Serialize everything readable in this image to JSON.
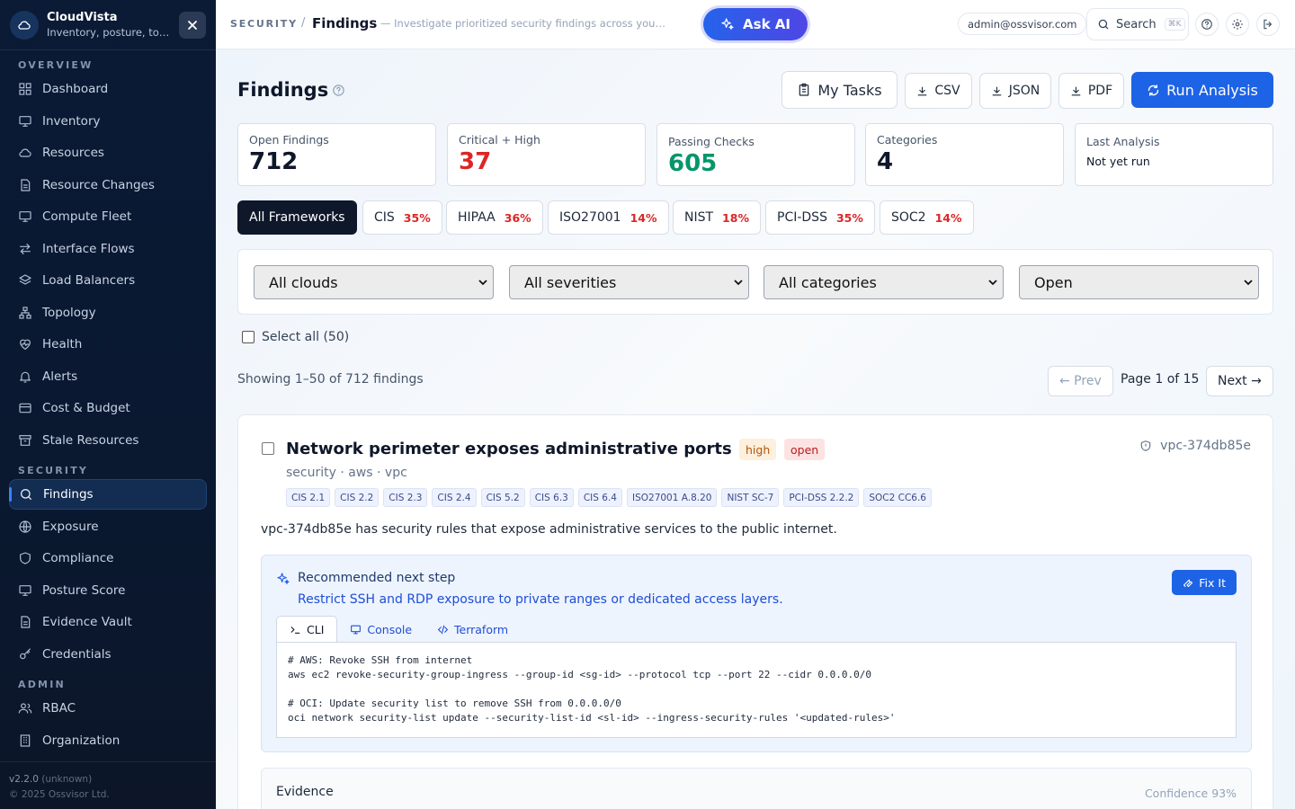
{
  "app": {
    "name": "CloudVista",
    "tagline": "Inventory, posture, topology"
  },
  "sidebar": {
    "sections": {
      "overview": "OVERVIEW",
      "security": "SECURITY",
      "admin": "ADMIN"
    },
    "overview_items": [
      {
        "label": "Dashboard",
        "icon": "dashboard-icon"
      },
      {
        "label": "Inventory",
        "icon": "monitor-icon"
      },
      {
        "label": "Resources",
        "icon": "cloud-icon"
      },
      {
        "label": "Resource Changes",
        "icon": "document-icon"
      },
      {
        "label": "Compute Fleet",
        "icon": "monitor-icon"
      },
      {
        "label": "Interface Flows",
        "icon": "arrows-icon"
      },
      {
        "label": "Load Balancers",
        "icon": "layers-icon"
      },
      {
        "label": "Topology",
        "icon": "network-icon"
      },
      {
        "label": "Health",
        "icon": "heart-pulse-icon"
      },
      {
        "label": "Alerts",
        "icon": "bell-icon"
      },
      {
        "label": "Cost & Budget",
        "icon": "wallet-icon"
      },
      {
        "label": "Stale Resources",
        "icon": "archive-icon"
      }
    ],
    "security_items": [
      {
        "label": "Findings",
        "icon": "search-icon",
        "active": true
      },
      {
        "label": "Exposure",
        "icon": "globe-icon"
      },
      {
        "label": "Compliance",
        "icon": "shield-icon"
      },
      {
        "label": "Posture Score",
        "icon": "monitor-icon"
      },
      {
        "label": "Evidence Vault",
        "icon": "document-icon"
      },
      {
        "label": "Credentials",
        "icon": "key-icon"
      }
    ],
    "admin_items": [
      {
        "label": "RBAC",
        "icon": "users-icon"
      },
      {
        "label": "Organization",
        "icon": "building-icon"
      }
    ],
    "version": "v2.2.0",
    "version_note": "(unknown)",
    "copyright": "© 2025 Ossvisor Ltd."
  },
  "topbar": {
    "section": "SECURITY",
    "separator": "/",
    "page": "Findings",
    "description": "— Investigate prioritized security findings across your t...",
    "ask_ai": "Ask AI",
    "user": "admin@ossvisor.com",
    "search": "Search",
    "search_shortcut": "⌘K"
  },
  "page": {
    "title": "Findings",
    "buttons": {
      "tasks": "My Tasks",
      "csv": "CSV",
      "json": "JSON",
      "pdf": "PDF",
      "run": "Run Analysis"
    },
    "stats": [
      {
        "label": "Open Findings",
        "value": "712",
        "color": "#0f172a"
      },
      {
        "label": "Critical + High",
        "value": "37",
        "color": "#dc2626"
      },
      {
        "label": "Passing Checks",
        "value": "605",
        "color": "#059669"
      },
      {
        "label": "Categories",
        "value": "4",
        "color": "#0f172a"
      },
      {
        "label": "Last Analysis",
        "value": "Not yet run",
        "color": "#0f172a"
      }
    ],
    "frameworks": [
      {
        "label": "All Frameworks",
        "pct": "",
        "active": true
      },
      {
        "label": "CIS",
        "pct": "35%"
      },
      {
        "label": "HIPAA",
        "pct": "36%"
      },
      {
        "label": "ISO27001",
        "pct": "14%"
      },
      {
        "label": "NIST",
        "pct": "18%"
      },
      {
        "label": "PCI-DSS",
        "pct": "35%"
      },
      {
        "label": "SOC2",
        "pct": "14%"
      }
    ],
    "filters": {
      "cloud": "All clouds",
      "severity": "All severities",
      "category": "All categories",
      "status": "Open"
    },
    "select_all": "Select all (50)",
    "showing": "Showing 1–50 of 712 findings",
    "pagination": {
      "prev": "← Prev",
      "page": "Page 1 of 15",
      "next": "Next →"
    }
  },
  "finding": {
    "title": "Network perimeter exposes administrative ports",
    "severity": "high",
    "status": "open",
    "resource": "vpc-374db85e",
    "meta": "security · aws · vpc",
    "tags": [
      "CIS 2.1",
      "CIS 2.2",
      "CIS 2.3",
      "CIS 2.4",
      "CIS 5.2",
      "CIS 6.3",
      "CIS 6.4",
      "ISO27001 A.8.20",
      "NIST SC-7",
      "PCI-DSS 2.2.2",
      "SOC2 CC6.6"
    ],
    "description": "vpc-374db85e has security rules that expose administrative services to the public internet.",
    "recommendation": {
      "title": "Recommended next step",
      "text": "Restrict SSH and RDP exposure to private ranges or dedicated access layers.",
      "fix_button": "Fix It",
      "tabs": [
        "CLI",
        "Console",
        "Terraform"
      ],
      "code": "# AWS: Revoke SSH from internet\naws ec2 revoke-security-group-ingress --group-id <sg-id> --protocol tcp --port 22 --cidr 0.0.0.0/0\n\n# OCI: Update security list to remove SSH from 0.0.0.0/0\noci network security-list update --security-list-id <sl-id> --ingress-security-rules '<updated-rules>'"
    },
    "evidence": {
      "title": "Evidence",
      "confidence": "Confidence 93%"
    }
  }
}
